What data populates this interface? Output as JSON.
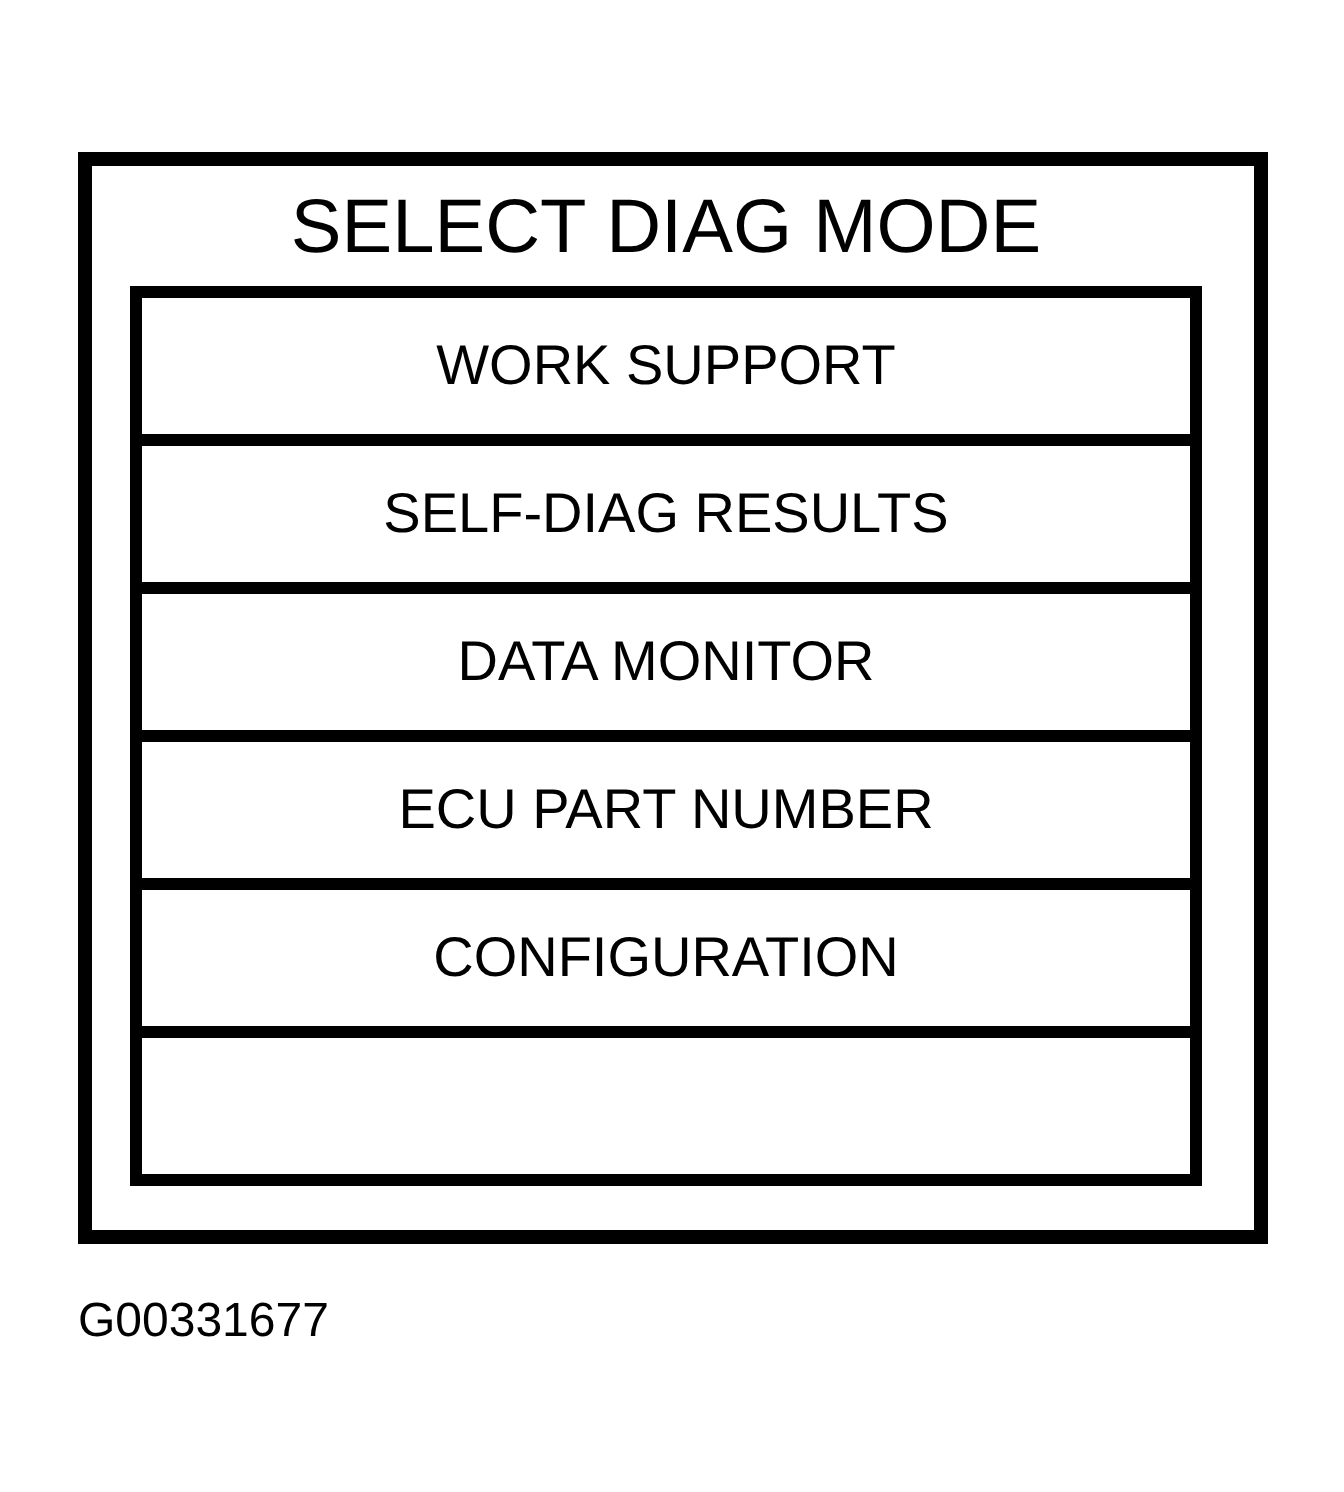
{
  "screen": {
    "title": "SELECT DIAG MODE",
    "menu": [
      {
        "kind": "option",
        "label": "WORK SUPPORT"
      },
      {
        "kind": "option",
        "label": "SELF-DIAG RESULTS"
      },
      {
        "kind": "option",
        "label": "DATA MONITOR"
      },
      {
        "kind": "option",
        "label": "ECU PART NUMBER"
      },
      {
        "kind": "option",
        "label": "CONFIGURATION"
      },
      {
        "kind": "blank"
      }
    ]
  },
  "figure_id": "G00331677"
}
